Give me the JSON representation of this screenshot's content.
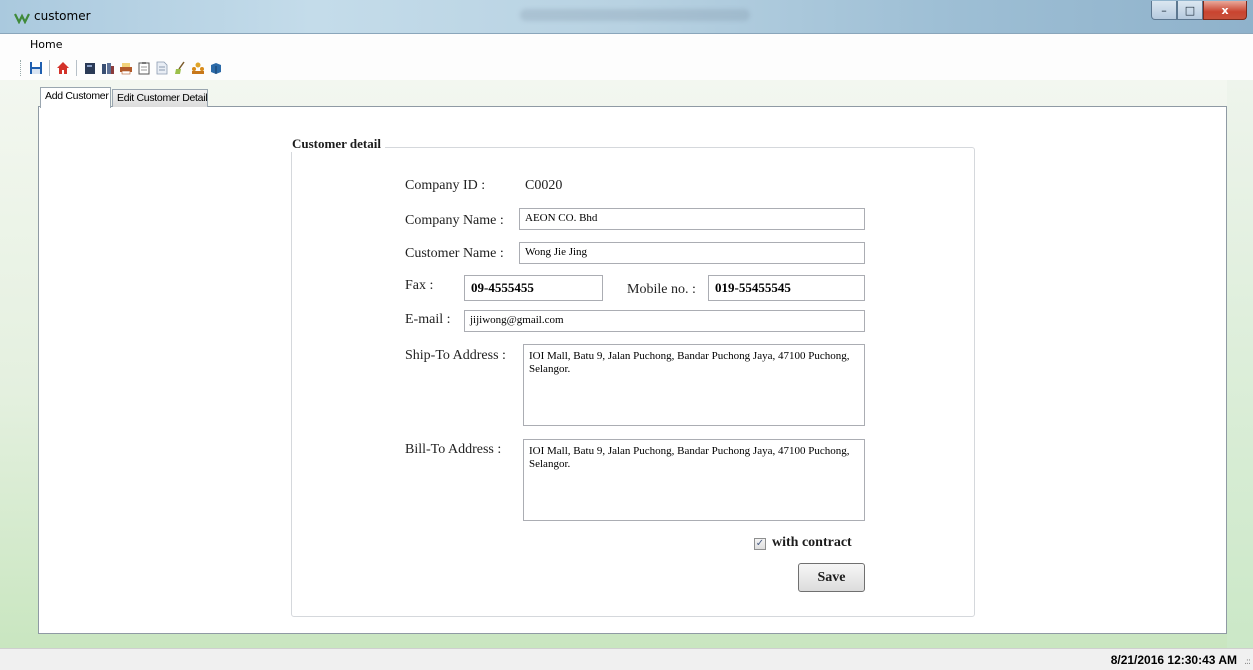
{
  "window": {
    "title": "customer",
    "controls": {
      "minimize": "–",
      "maximize": "□",
      "close": "x"
    }
  },
  "menu": {
    "items": [
      {
        "label": "Home"
      }
    ]
  },
  "toolbar": {
    "icons": [
      "save-icon",
      "home-icon",
      "book-icon",
      "books-icon",
      "printer-icon",
      "clipboard-icon",
      "document-icon",
      "broom-icon",
      "users-icon",
      "box-icon"
    ]
  },
  "tabs": [
    {
      "label": "Add Customer",
      "active": true
    },
    {
      "label": "Edit Customer Detail",
      "active": false
    }
  ],
  "form": {
    "group_title": "Customer detail",
    "company_id": {
      "label": "Company ID :",
      "value": "C0020"
    },
    "company_name": {
      "label": "Company Name :",
      "value": "AEON CO. Bhd"
    },
    "customer_name": {
      "label": "Customer Name :",
      "value": "Wong Jie Jing"
    },
    "fax": {
      "label": "Fax :",
      "value": "09-4555455"
    },
    "mobile": {
      "label": "Mobile no. :",
      "value": "019-55455545"
    },
    "email": {
      "label": "E-mail :",
      "value": "jijiwong@gmail.com"
    },
    "ship_to": {
      "label": "Ship-To Address :",
      "value": "IOI Mall, Batu 9, Jalan Puchong, Bandar Puchong Jaya, 47100 Puchong, Selangor."
    },
    "bill_to": {
      "label": "Bill-To Address :",
      "value": "IOI Mall, Batu 9, Jalan Puchong, Bandar Puchong Jaya, 47100 Puchong, Selangor."
    },
    "with_contract": {
      "label": "with contract",
      "checked": true,
      "mark": "✓"
    },
    "save_label": "Save"
  },
  "status": {
    "datetime": "8/21/2016 12:30:43 AM",
    "grip": ".::"
  },
  "colors": {
    "accent_green": "#c9e6c0",
    "title_glass": "#b8d2e2",
    "close_red": "#c94430"
  }
}
